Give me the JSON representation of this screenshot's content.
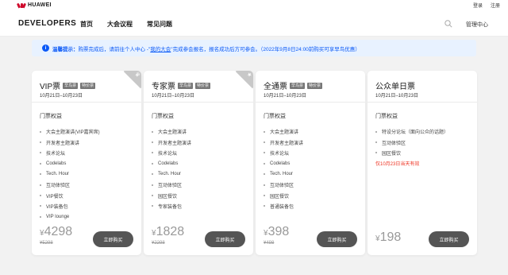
{
  "topbar": {
    "logo_text": "HUAWEI",
    "login": "登录",
    "register": "注册"
  },
  "navbar": {
    "brand": "DEVELOPERS",
    "items": [
      "首页",
      "大会议程",
      "常见问题"
    ],
    "admin": "管理中心"
  },
  "notice": {
    "label": "温馨提示：",
    "text_before": "购票完成后，请前往个人中心 -\"",
    "link": "我的大会",
    "text_after": "\"完成参会报名，报名成功后方可参会。（2022年9月8日24:00前购买可享早鸟优惠）"
  },
  "tickets": [
    {
      "name": "VIP票",
      "badges": [
        "早鸟票",
        "特价票"
      ],
      "date": "10月21日–10月23日",
      "rights_title": "门票权益",
      "benefits": [
        "大会主题演讲(VIP嘉宾席)",
        "开发者主题演讲",
        "技术论坛",
        "Codelabs",
        "Tech. Hour",
        "互动体验区",
        "VIP餐饮",
        "VIP装备包",
        "VIP lounge"
      ],
      "currency": "¥",
      "price": "4298",
      "old_price": "¥5298",
      "buy": "立即购买"
    },
    {
      "name": "专家票",
      "badges": [
        "早鸟票",
        "特价票"
      ],
      "date": "10月21日–10月23日",
      "rights_title": "门票权益",
      "benefits": [
        "大会主题演讲",
        "开发者主题演讲",
        "技术论坛",
        "Codelabs",
        "Tech. Hour",
        "互动体验区",
        "园区餐饮",
        "专家装备包"
      ],
      "currency": "¥",
      "price": "1828",
      "old_price": "¥2298",
      "buy": "立即购买"
    },
    {
      "name": "全通票",
      "badges": [
        "早鸟票",
        "特价票"
      ],
      "date": "10月21日–10月23日",
      "rights_title": "门票权益",
      "benefits": [
        "大会主题演讲",
        "开发者主题演讲",
        "技术论坛",
        "Codelabs",
        "Tech. Hour",
        "互动体验区",
        "园区餐饮",
        "普通装备包"
      ],
      "currency": "¥",
      "price": "398",
      "old_price": "¥498",
      "buy": "立即购买"
    },
    {
      "name": "公众单日票",
      "badges": [],
      "date": "10月21日–10月23日",
      "rights_title": "门票权益",
      "benefits": [
        "特设分论坛（面向公众的话题）",
        "互动体验区",
        "园区餐饮"
      ],
      "warning": "仅10月23日当天有效",
      "currency": "¥",
      "price": "198",
      "old_price": "",
      "buy": "立即购买"
    }
  ],
  "colors": {
    "brand_red": "#cf0a2c",
    "notice_blue": "#0a59f7",
    "warning_red": "#ee3322",
    "button_gray": "#555555"
  }
}
